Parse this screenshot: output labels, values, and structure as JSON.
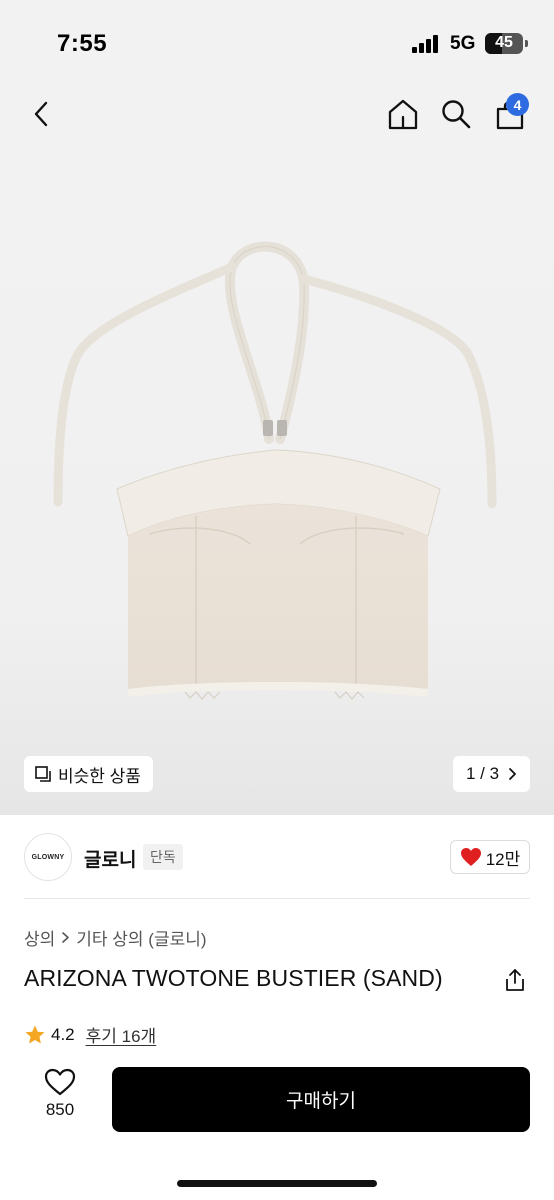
{
  "status_bar": {
    "time": "7:55",
    "network": "5G",
    "battery": "45",
    "battery_fraction": 0.45
  },
  "nav": {
    "back_icon": "chevron-left-icon",
    "home_icon": "home-icon",
    "search_icon": "search-icon",
    "cart_icon": "shopping-bag-icon",
    "cart_count": "4"
  },
  "gallery": {
    "similar_label": "비슷한 상품",
    "page_indicator": "1 / 3"
  },
  "brand": {
    "logo_text": "GLOWNY",
    "name": "글로니",
    "badge": "단독",
    "likes": "12만"
  },
  "product": {
    "breadcrumb": [
      "상의",
      "기타 상의 (글로니)"
    ],
    "title": "ARIZONA TWOTONE BUSTIER (SAND)",
    "rating": "4.2",
    "review_label": "후기 16개"
  },
  "bottom_bar": {
    "wish_count": "850",
    "buy_label": "구매하기"
  },
  "colors": {
    "accent": "#2f6be0",
    "heart": "#e02020",
    "star": "#f5a623",
    "buy_button": "#000000"
  }
}
